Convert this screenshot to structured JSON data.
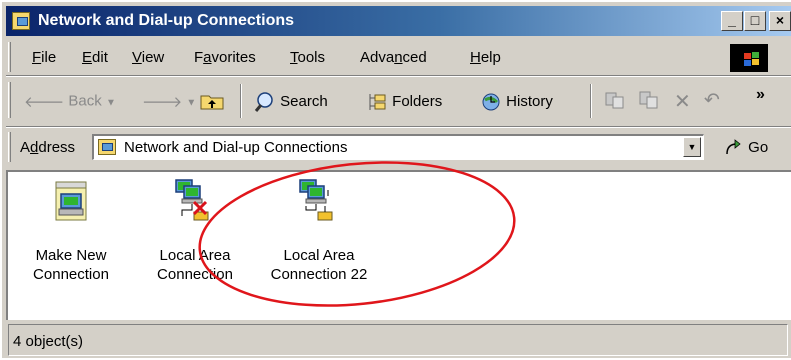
{
  "window": {
    "title": "Network and Dial-up Connections",
    "controls": {
      "minimize": "_",
      "maximize": "□",
      "close": "×"
    }
  },
  "menubar": {
    "items": [
      {
        "pre": "",
        "key": "F",
        "post": "ile"
      },
      {
        "pre": "",
        "key": "E",
        "post": "dit"
      },
      {
        "pre": "",
        "key": "V",
        "post": "iew"
      },
      {
        "pre": "F",
        "key": "a",
        "post": "vorites"
      },
      {
        "pre": "",
        "key": "T",
        "post": "ools"
      },
      {
        "pre": "Adva",
        "key": "n",
        "post": "ced"
      },
      {
        "pre": "",
        "key": "H",
        "post": "elp"
      }
    ]
  },
  "toolbar": {
    "back": "Back",
    "search": "Search",
    "folders": "Folders",
    "history": "History",
    "overflow": "»"
  },
  "addressbar": {
    "label_pre": "A",
    "label_key": "d",
    "label_post": "dress",
    "value": "Network and Dial-up Connections",
    "go": "Go"
  },
  "content": {
    "items": [
      {
        "label": "Make New\nConnection",
        "icon": "new-connection-icon"
      },
      {
        "label": "Local Area\nConnection",
        "icon": "disconnected-network-icon"
      },
      {
        "label": "Local Area\nConnection 22",
        "icon": "network-connection-icon"
      }
    ]
  },
  "statusbar": {
    "text": "4 object(s)"
  },
  "colors": {
    "title_gradient_start": "#0a246a",
    "title_gradient_end": "#a6caf0",
    "chrome": "#d4d0c8",
    "annotation": "#e0161b"
  }
}
